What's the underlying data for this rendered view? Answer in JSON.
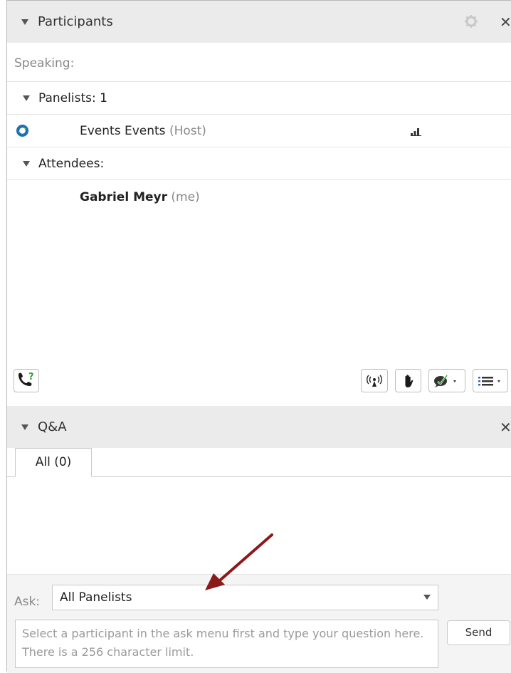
{
  "participants": {
    "title": "Participants",
    "speaking_label": "Speaking:",
    "panelists_label": "Panelists: 1",
    "host": {
      "name": "Events Events",
      "role": "(Host)"
    },
    "attendees_label": "Attendees:",
    "me": {
      "name": "Gabriel Meyr",
      "tag": "(me)"
    },
    "icons": [
      "gear-icon",
      "close-icon",
      "host-avatar-icon",
      "signal-bars-icon",
      "phone-question-icon",
      "broadcast-icon",
      "raise-hand-icon",
      "emoticon-menu-icon",
      "list-menu-icon"
    ]
  },
  "qa": {
    "title": "Q&A",
    "tab_all": "All (0)",
    "ask_label": "Ask:",
    "ask_value": "All Panelists",
    "question_placeholder": "Select a participant in the ask menu first and type your question here. There is a 256 character limit.",
    "send_label": "Send"
  },
  "colors": {
    "header_bg": "#ebebeb",
    "arrow": "#8b1a1a",
    "phone_green": "#2fa32f"
  }
}
